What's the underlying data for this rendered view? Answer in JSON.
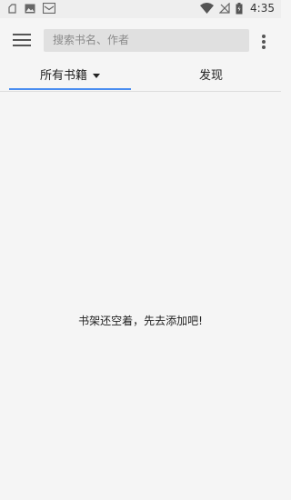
{
  "status_bar": {
    "time": "4:35",
    "left_icons": [
      "notification-icon",
      "image-icon",
      "mail-icon"
    ],
    "right_icons": [
      "wifi-icon",
      "no-signal-icon",
      "battery-icon"
    ]
  },
  "toolbar": {
    "search_placeholder": "搜索书名、作者"
  },
  "tabs": [
    {
      "label": "所有书籍",
      "active": true,
      "has_dropdown": true
    },
    {
      "label": "发现",
      "active": false
    }
  ],
  "main": {
    "empty_message": "书架还空着，先去添加吧!"
  },
  "colors": {
    "accent": "#4a8df0",
    "background": "#f5f5f5",
    "search_bg": "#e0e0e0"
  }
}
